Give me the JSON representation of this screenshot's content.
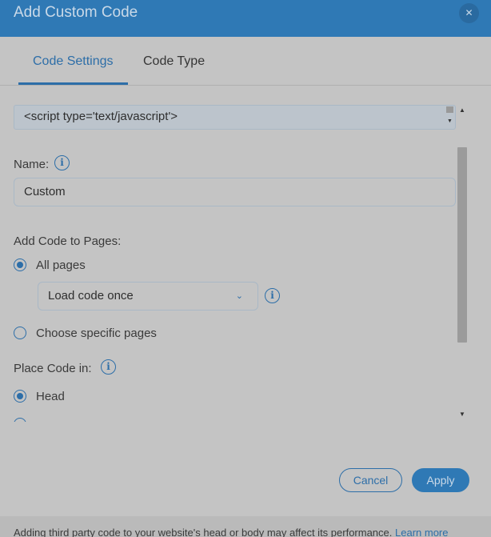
{
  "header": {
    "title": "Add Custom Code",
    "close_glyph": "✕"
  },
  "tabs": [
    {
      "label": "Code Settings",
      "active": true
    },
    {
      "label": "Code Type",
      "active": false
    }
  ],
  "code_box": {
    "value": "<script type='text/javascript'>"
  },
  "name_field": {
    "label": "Name:",
    "value": "Custom"
  },
  "pages": {
    "label": "Add Code to Pages:",
    "options": [
      {
        "label": "All pages",
        "selected": true
      },
      {
        "label": "Choose specific pages",
        "selected": false
      }
    ],
    "load_select": {
      "value": "Load code once"
    }
  },
  "place": {
    "label": "Place Code in:",
    "options": [
      {
        "label": "Head",
        "selected": true
      }
    ]
  },
  "buttons": {
    "cancel": "Cancel",
    "apply": "Apply"
  },
  "footer": {
    "text": "Adding third party code to your website's head or body may affect its performance. ",
    "link": "Learn more"
  },
  "icons": {
    "info": "info-icon",
    "close": "close-icon",
    "chevron": "chevron-down-icon"
  },
  "colors": {
    "accent": "#2d6ea8",
    "header_bg": "#2f79b5",
    "overlay_bg": "#c4c4c4"
  }
}
